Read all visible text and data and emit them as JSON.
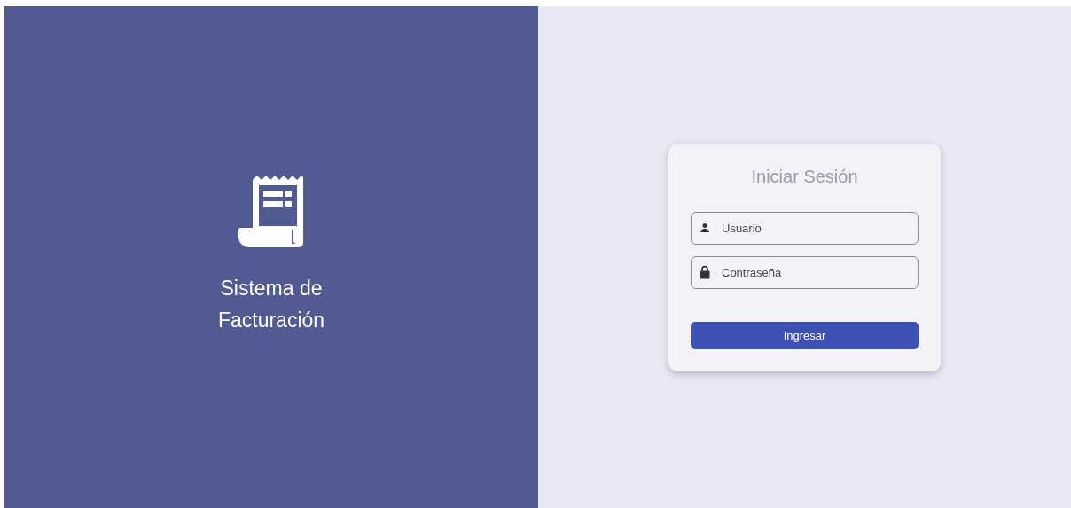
{
  "brand": {
    "title": "Sistema de Facturación"
  },
  "login": {
    "title": "Iniciar Sesión",
    "fields": [
      {
        "kind": "user",
        "placeholder": "Usuario"
      },
      {
        "kind": "password",
        "placeholder": "Contraseña"
      }
    ],
    "submit": "Ingresar"
  }
}
